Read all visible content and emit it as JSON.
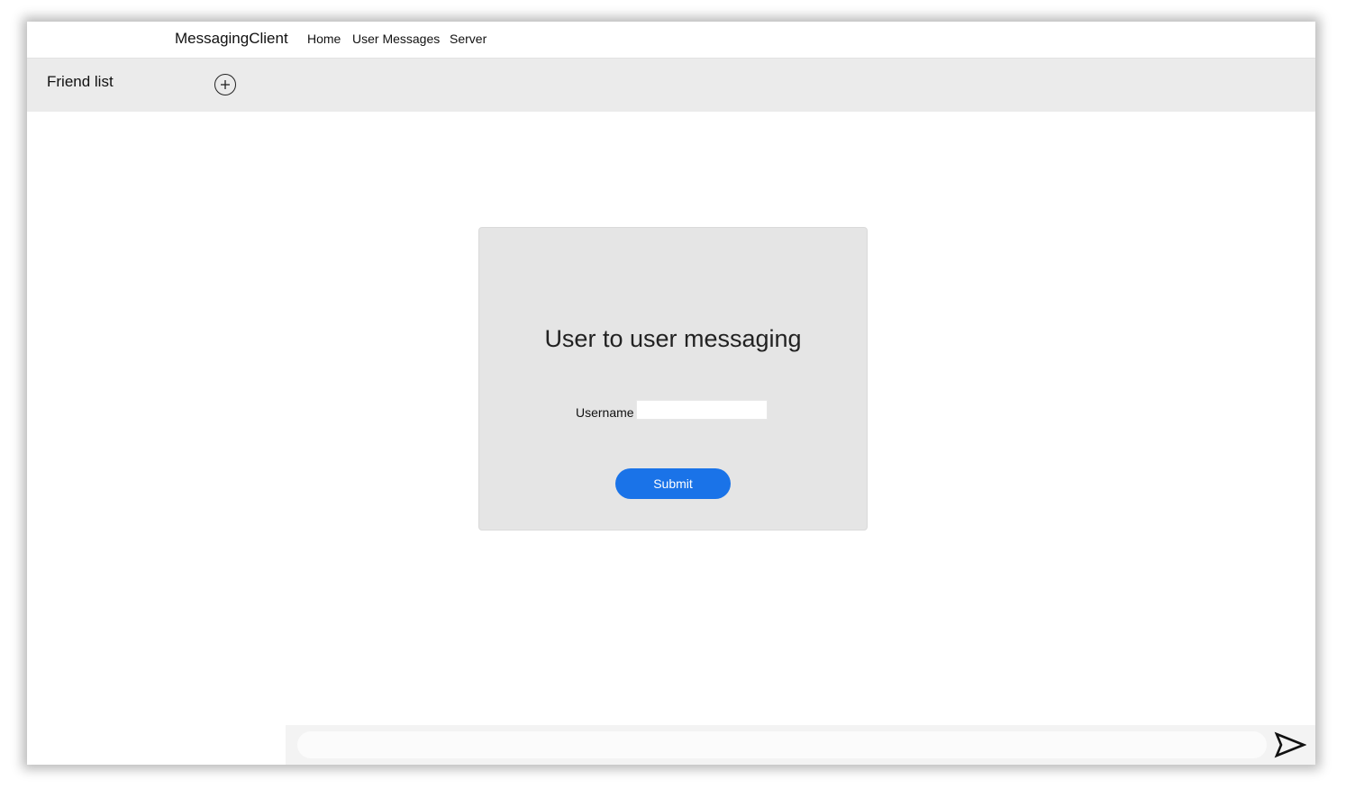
{
  "navbar": {
    "brand": "MessagingClient",
    "links": [
      "Home",
      "User Messages",
      "Server"
    ]
  },
  "friends": {
    "title": "Friend list",
    "add_icon": "plus-circle-icon"
  },
  "login_card": {
    "title": "User to user messaging",
    "username_label": "Username",
    "username_value": "",
    "submit_label": "Submit"
  },
  "composer": {
    "message_value": "",
    "send_icon": "send-arrow-icon"
  },
  "colors": {
    "accent": "#1a73e8",
    "friendbar_bg": "#ebebeb",
    "card_bg": "#e5e5e5"
  }
}
